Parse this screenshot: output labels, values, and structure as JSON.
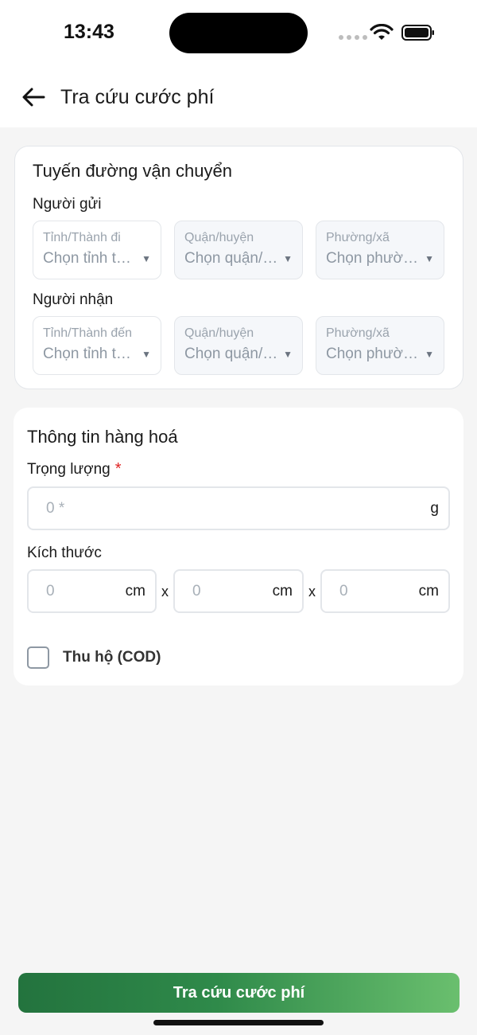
{
  "status_bar": {
    "time": "13:43"
  },
  "header": {
    "title": "Tra cứu cước phí"
  },
  "route": {
    "title": "Tuyến đường vận chuyển",
    "sender": {
      "label": "Người gửi",
      "province": {
        "label": "Tỉnh/Thành đi",
        "value": "Chọn tỉnh thành"
      },
      "district": {
        "label": "Quận/huyện",
        "value": "Chọn quận/huyện"
      },
      "ward": {
        "label": "Phường/xã",
        "value": "Chọn phường/xã"
      }
    },
    "receiver": {
      "label": "Người nhận",
      "province": {
        "label": "Tỉnh/Thành đến",
        "value": "Chọn tỉnh thành"
      },
      "district": {
        "label": "Quận/huyện",
        "value": "Chọn quận/huyện"
      },
      "ward": {
        "label": "Phường/xã",
        "value": "Chọn phường/xã"
      }
    }
  },
  "goods": {
    "title": "Thông tin hàng hoá",
    "weight": {
      "label": "Trọng lượng",
      "required_mark": "*",
      "placeholder": "0 *",
      "unit": "g"
    },
    "size": {
      "label": "Kích thước",
      "length": {
        "placeholder": "0",
        "unit": "cm"
      },
      "width": {
        "placeholder": "0",
        "unit": "cm"
      },
      "height": {
        "placeholder": "0",
        "unit": "cm"
      },
      "separator": "x"
    },
    "cod": {
      "label": "Thu hộ (COD)",
      "checked": false
    }
  },
  "footer": {
    "submit_label": "Tra cứu cước phí"
  },
  "colors": {
    "accent_start": "#23733e",
    "accent_end": "#6abf6e",
    "required": "#e02424",
    "background": "#f5f5f5"
  }
}
